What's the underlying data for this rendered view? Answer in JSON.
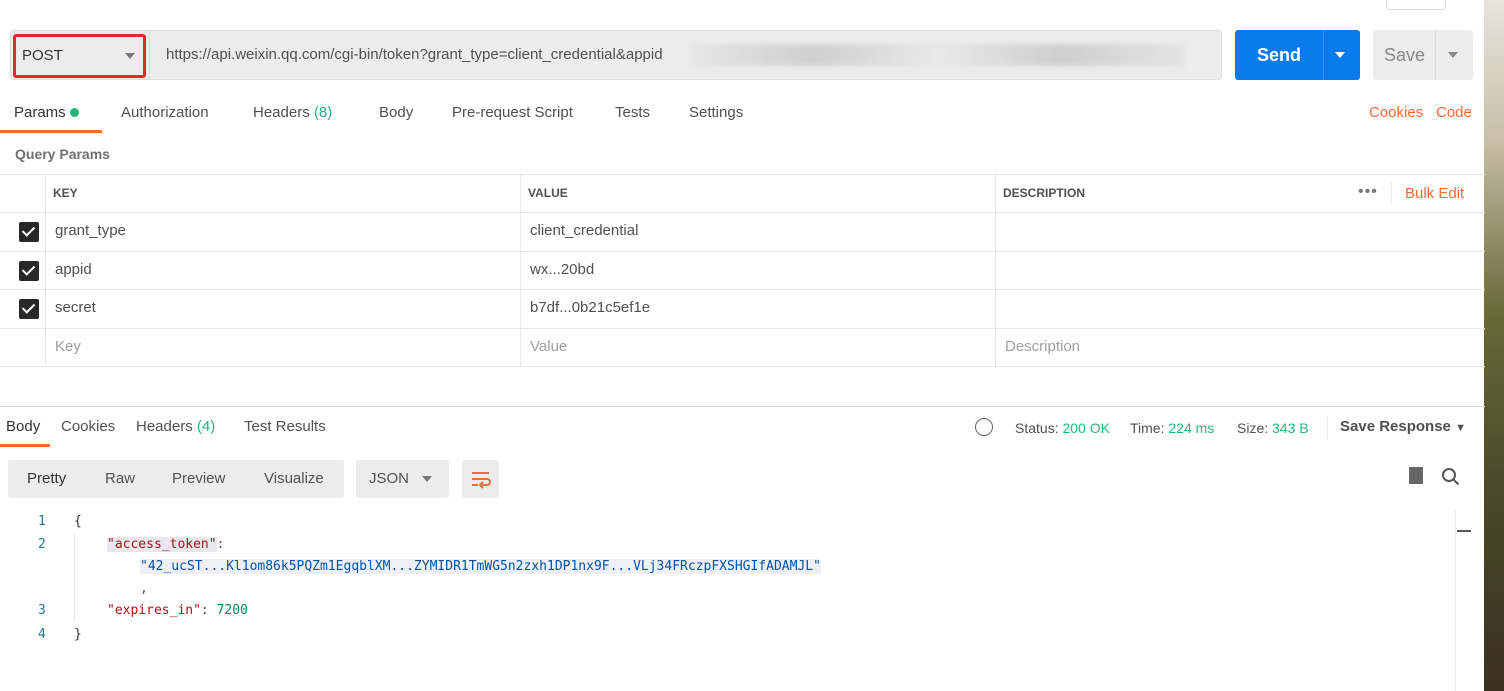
{
  "request": {
    "method": "POST",
    "url": "https://api.weixin.qq.com/cgi-bin/token?grant_type=client_credential&appid",
    "send_label": "Send",
    "save_label": "Save"
  },
  "request_tabs": [
    {
      "label": "Params"
    },
    {
      "label": "Authorization"
    },
    {
      "label": "Headers",
      "count": "(8)"
    },
    {
      "label": "Body"
    },
    {
      "label": "Pre-request Script"
    },
    {
      "label": "Tests"
    },
    {
      "label": "Settings"
    }
  ],
  "links": {
    "cookies": "Cookies",
    "code": "Code"
  },
  "params": {
    "title": "Query Params",
    "headers": [
      "KEY",
      "VALUE",
      "DESCRIPTION"
    ],
    "bulk_edit": "Bulk Edit",
    "rows": [
      {
        "key": "grant_type",
        "value": "client_credential",
        "checked": true
      },
      {
        "key": "appid",
        "value": "wx...20bd",
        "checked": true
      },
      {
        "key": "secret",
        "value": "b7df...0b21c5ef1e",
        "checked": true
      }
    ],
    "placeholders": {
      "key": "Key",
      "value": "Value",
      "description": "Description"
    }
  },
  "response_tabs": [
    {
      "label": "Body"
    },
    {
      "label": "Cookies"
    },
    {
      "label": "Headers",
      "count": "(4)"
    },
    {
      "label": "Test Results"
    }
  ],
  "response_meta": {
    "status_label": "Status:",
    "status": "200 OK",
    "time_label": "Time:",
    "time": "224 ms",
    "size_label": "Size:",
    "size": "343 B",
    "save_response": "Save Response"
  },
  "view_modes": [
    "Pretty",
    "Raw",
    "Preview",
    "Visualize"
  ],
  "format": "JSON",
  "body_lines": {
    "l1": "{",
    "key1": "\"access_token\"",
    "colon": ":",
    "token": "\"42_ucST...Kl1om86k5PQZm1EgqblXM...ZYMIDR1TmWG5n2zxh1DP1nx9F...VLj34FRczpFXSHGIfADAMJL\"",
    "comma": ",",
    "key2": "\"expires_in\"",
    "val2": "7200",
    "l4": "}"
  },
  "colors": {
    "accent": "#f26b3a",
    "send": "#097bed",
    "success": "#26b47f",
    "highlight_box": "#e8262b"
  }
}
